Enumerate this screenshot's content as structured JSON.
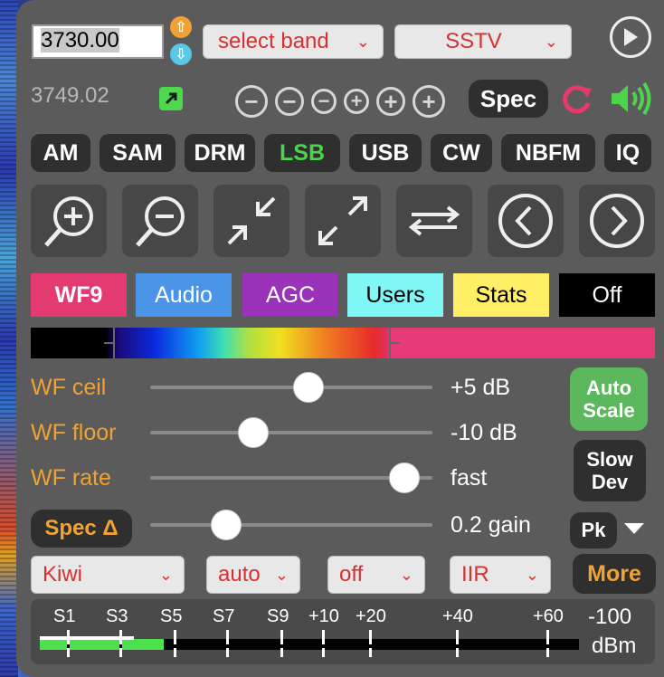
{
  "frequency": {
    "value": "3730.00",
    "secondary": "3749.02"
  },
  "band_select": {
    "label": "select band"
  },
  "mode_select": {
    "label": "SSTV"
  },
  "spec_button": {
    "label": "Spec"
  },
  "modes": [
    "AM",
    "SAM",
    "DRM",
    "LSB",
    "USB",
    "CW",
    "NBFM",
    "IQ"
  ],
  "active_mode": "LSB",
  "tabs": [
    {
      "label": "WF9",
      "bg": "#e33a72",
      "color": "#ffffff",
      "bold": true
    },
    {
      "label": "Audio",
      "bg": "#4a95e8",
      "color": "#ffffff",
      "bold": false
    },
    {
      "label": "AGC",
      "bg": "#9b33b8",
      "color": "#ffffff",
      "bold": false
    },
    {
      "label": "Users",
      "bg": "#7ff7f7",
      "color": "#000000",
      "bold": false
    },
    {
      "label": "Stats",
      "bg": "#ffee66",
      "color": "#000000",
      "bold": false
    },
    {
      "label": "Off",
      "bg": "#000000",
      "color": "#ffffff",
      "bold": false
    }
  ],
  "sliders": [
    {
      "label": "WF ceil",
      "value": "+5 dB",
      "level": 0.57
    },
    {
      "label": "WF floor",
      "value": "-10 dB",
      "level": 0.35
    },
    {
      "label": "WF rate",
      "value": "fast",
      "level": 0.95
    }
  ],
  "spec_delta": {
    "label": "Spec Δ",
    "value": "0.2 gain",
    "level": 0.24
  },
  "auto_scale": {
    "line1": "Auto",
    "line2": "Scale"
  },
  "slow_dev": {
    "line1": "Slow",
    "line2": "Dev"
  },
  "pk": {
    "label": "Pk"
  },
  "bottom_selects": [
    "Kiwi",
    "auto",
    "off",
    "IIR"
  ],
  "more": {
    "label": "More"
  },
  "smeter": {
    "labels": [
      "S1",
      "S3",
      "S5",
      "S7",
      "S9",
      "+10",
      "+20",
      "+40",
      "+60"
    ],
    "reading": "-100",
    "unit": "dBm",
    "level": 0.23
  },
  "colors": {
    "accent_orange": "#f0a232",
    "accent_green": "#4cd44c",
    "panel": "#5b5b5b",
    "select_text": "#d83030"
  }
}
